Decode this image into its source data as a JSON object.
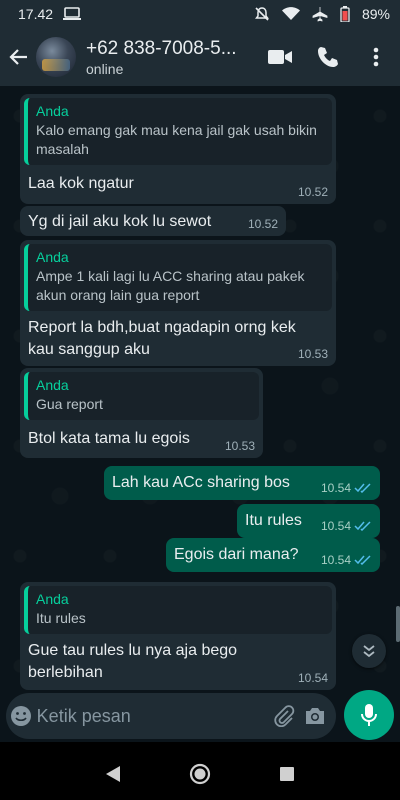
{
  "status_bar": {
    "time": "17.42",
    "battery": "89%"
  },
  "header": {
    "contact_name": "+62 838-7008-5...",
    "contact_status": "online"
  },
  "messages": [
    {
      "dir": "in",
      "quote_author": "Anda",
      "quote_text": "Kalo emang gak mau kena jail gak usah bikin masalah",
      "text": "Laa kok ngatur",
      "time": "10.52"
    },
    {
      "dir": "in",
      "text": "Yg di jail aku kok lu sewot",
      "time": "10.52"
    },
    {
      "dir": "in",
      "quote_author": "Anda",
      "quote_text": "Ampe 1 kali lagi lu ACC sharing atau pakek akun orang lain gua report",
      "text": "Report la bdh,buat ngadapin orng kek kau sanggup aku",
      "time": "10.53"
    },
    {
      "dir": "in",
      "quote_author": "Anda",
      "quote_text": "Gua report",
      "text": "Btol kata tama lu egois",
      "time": "10.53"
    },
    {
      "dir": "out",
      "text": "Lah kau ACc sharing bos",
      "time": "10.54"
    },
    {
      "dir": "out",
      "text": "Itu rules",
      "time": "10.54"
    },
    {
      "dir": "out",
      "text": "Egois dari mana?",
      "time": "10.54"
    },
    {
      "dir": "in",
      "quote_author": "Anda",
      "quote_text": "Itu rules",
      "text": "Gue tau rules lu nya aja bego berlebihan",
      "time": "10.54"
    }
  ],
  "composer": {
    "placeholder": "Ketik pesan"
  },
  "colors": {
    "header_bg": "#1f2c34",
    "chat_bg": "#0b141a",
    "incoming_bubble": "#1f2c34",
    "outgoing_bubble": "#005c4b",
    "accent": "#00a884",
    "quote_accent": "#06cf9c",
    "read_ticks": "#53bdeb"
  }
}
